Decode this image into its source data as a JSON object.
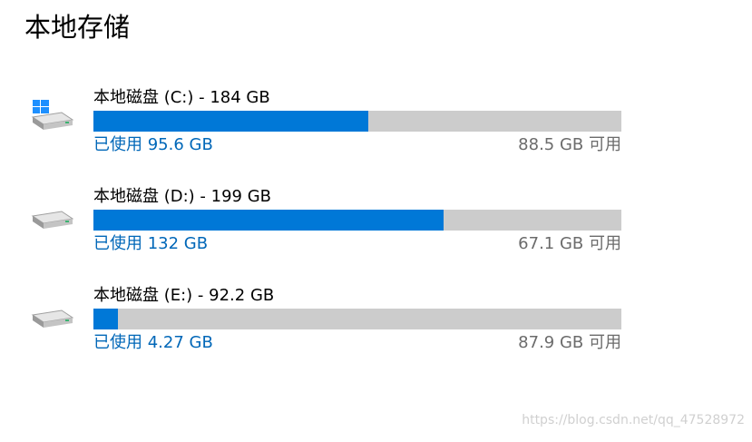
{
  "page": {
    "title": "本地存储"
  },
  "drives": [
    {
      "name": "本地磁盘 (C:) - 184 GB",
      "used": "已使用 95.6 GB",
      "free": "88.5 GB 可用",
      "used_fraction": 0.52,
      "icon": "system-drive-icon"
    },
    {
      "name": "本地磁盘 (D:) - 199 GB",
      "used": "已使用 132 GB",
      "free": "67.1 GB 可用",
      "used_fraction": 0.663,
      "icon": "drive-icon"
    },
    {
      "name": "本地磁盘 (E:) - 92.2 GB",
      "used": "已使用 4.27 GB",
      "free": "87.9 GB 可用",
      "used_fraction": 0.046,
      "icon": "drive-icon"
    }
  ],
  "watermark": "https://blog.csdn.net/qq_47528972",
  "colors": {
    "used_bar": "#0078d7",
    "track": "#cccccc",
    "link": "#0067b8",
    "free_text": "#6b6b6b"
  }
}
